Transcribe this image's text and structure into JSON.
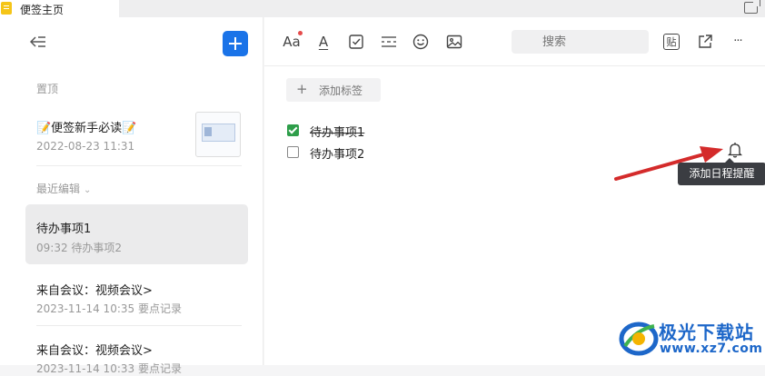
{
  "window": {
    "tab_title": "便签主页"
  },
  "sidebar": {
    "pinned_label": "置顶",
    "pinned_note": {
      "title": "📝便签新手必读📝",
      "timestamp": "2022-08-23 11:31"
    },
    "recent_label": "最近编辑",
    "recent_chevron": "⌄",
    "notes": [
      {
        "title": "待办事项1",
        "subtitle": "09:32 待办事项2"
      },
      {
        "title": "来自会议：视频会议>",
        "subtitle": "2023-11-14 10:35 要点记录"
      },
      {
        "title": "来自会议：视频会议>",
        "subtitle": "2023-11-14 10:33 要点记录"
      }
    ]
  },
  "toolbar": {
    "font_label": "Aa",
    "text_color_label": "A",
    "search_placeholder": "搜索",
    "paste_label": "贴",
    "more_label": "···"
  },
  "editor": {
    "add_tag_plus": "+",
    "add_tag_label": "添加标签",
    "todos": [
      {
        "text": "待办事项1",
        "checked": true
      },
      {
        "text": "待办事项2",
        "checked": false
      }
    ],
    "reminder_tooltip": "添加日程提醒"
  },
  "watermark": {
    "name": "极光下载站",
    "url": "www.xz7.com"
  },
  "colors": {
    "accent": "#1a73e8",
    "check_green": "#2e9e4a",
    "annotation_arrow": "#d42b2b",
    "tooltip_bg": "#3b3d42"
  }
}
